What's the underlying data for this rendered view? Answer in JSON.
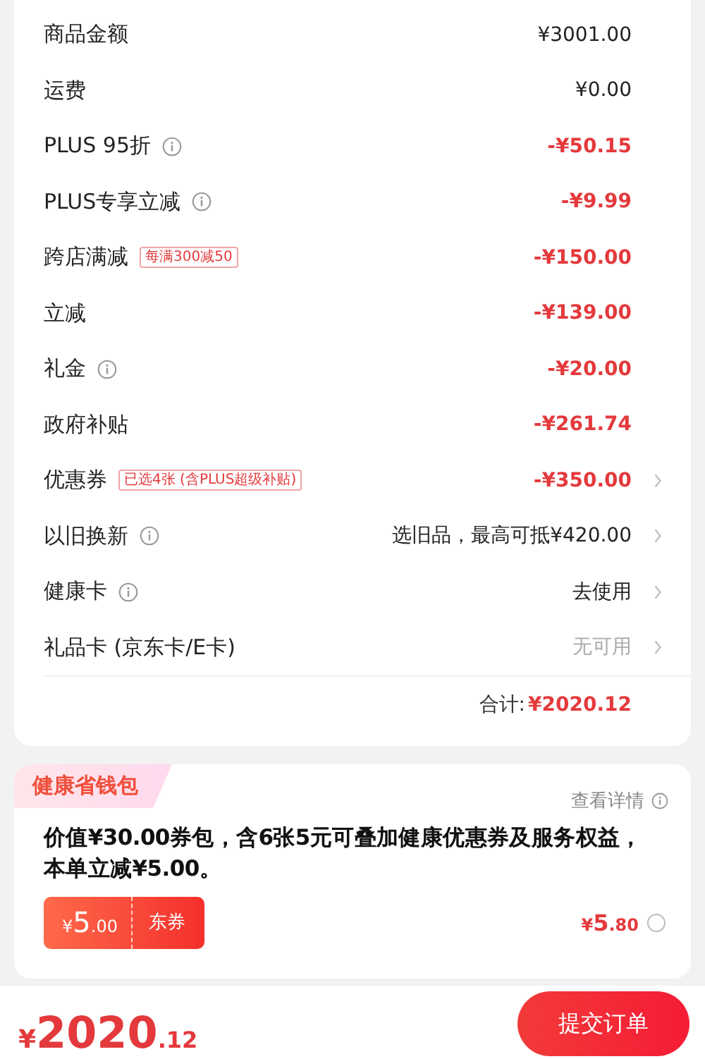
{
  "summary": {
    "rows": [
      {
        "label": "商品金额",
        "info": false,
        "tag": null,
        "value": "¥3001.00",
        "kind": "normal",
        "arrow": false
      },
      {
        "label": "运费",
        "info": false,
        "tag": null,
        "value": "¥0.00",
        "kind": "normal",
        "arrow": false
      },
      {
        "label": "PLUS 95折",
        "info": true,
        "tag": null,
        "value": "-¥50.15",
        "kind": "discount",
        "arrow": false
      },
      {
        "label": "PLUS专享立减",
        "info": true,
        "tag": null,
        "value": "-¥9.99",
        "kind": "discount",
        "arrow": false
      },
      {
        "label": "跨店满减",
        "info": false,
        "tag": "每满300减50",
        "value": "-¥150.00",
        "kind": "discount",
        "arrow": false
      },
      {
        "label": "立减",
        "info": false,
        "tag": null,
        "value": "-¥139.00",
        "kind": "discount",
        "arrow": false
      },
      {
        "label": "礼金",
        "info": true,
        "tag": null,
        "value": "-¥20.00",
        "kind": "discount",
        "arrow": false
      },
      {
        "label": "政府补贴",
        "info": false,
        "tag": null,
        "value": "-¥261.74",
        "kind": "discount",
        "arrow": false
      },
      {
        "label": "优惠券",
        "info": false,
        "tag": "已选4张 (含PLUS超级补贴)",
        "value": "-¥350.00",
        "kind": "discount",
        "arrow": true
      },
      {
        "label": "以旧换新",
        "info": true,
        "tag": null,
        "value": "选旧品，最高可抵¥420.00",
        "kind": "normal",
        "arrow": true
      },
      {
        "label": "健康卡",
        "info": true,
        "tag": null,
        "value": "去使用",
        "kind": "normal",
        "arrow": true
      },
      {
        "label": "礼品卡 (京东卡/E卡)",
        "info": false,
        "tag": null,
        "value": "无可用",
        "kind": "muted",
        "arrow": true
      }
    ],
    "total_label": "合计:",
    "total_value": "¥2020.12"
  },
  "wallet": {
    "title": "健康省钱包",
    "details_link": "查看详情",
    "description": "价值¥30.00券包，含6张5元可叠加健康优惠券及服务权益，本单**立减¥5.00。**",
    "coupon": {
      "currency": "¥",
      "amount": "5",
      "decimals": ".00",
      "label": "东券"
    },
    "price": {
      "currency": "¥",
      "amount": "5",
      "decimals": ".80"
    },
    "selected": false
  },
  "footer": {
    "currency": "¥",
    "amount": "2020",
    "decimals": ".12",
    "submit": "提交订单"
  }
}
